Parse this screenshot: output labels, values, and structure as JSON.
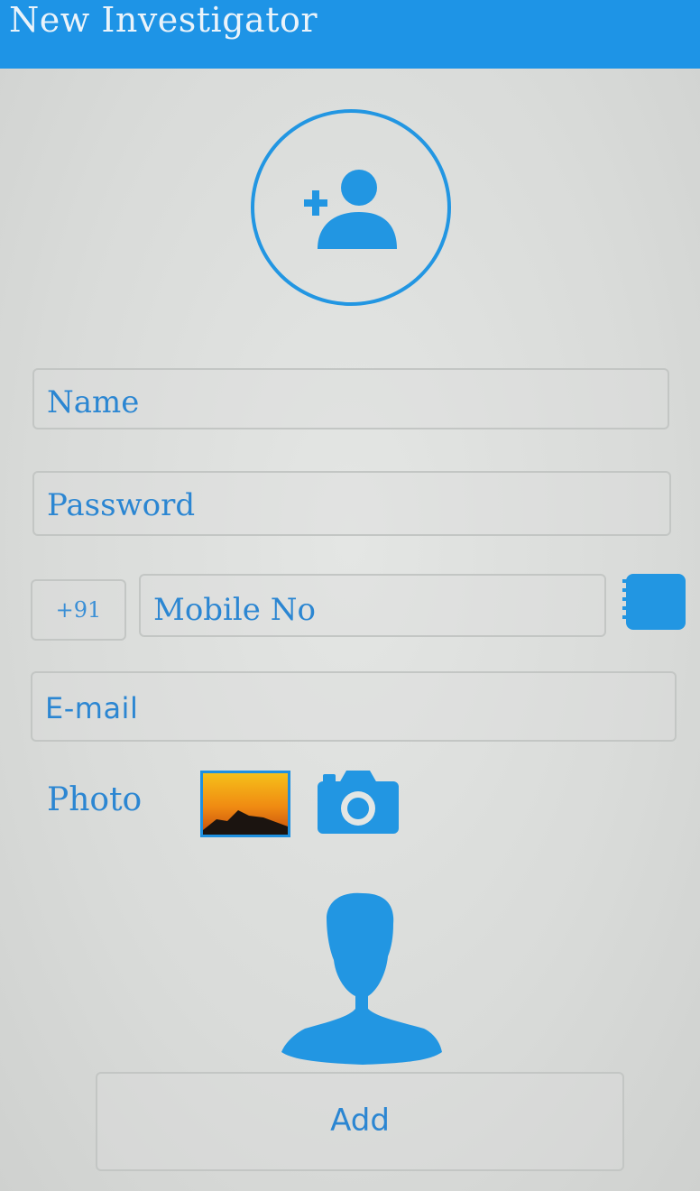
{
  "appbar": {
    "title": "New Investigator",
    "color": "#1e94e6"
  },
  "header_icon": "add-person-icon",
  "form": {
    "name_placeholder": "Name",
    "password_placeholder": "Password",
    "country_code": "+91",
    "mobile_placeholder": "Mobile No",
    "contacts_icon": "contacts-book-icon",
    "email_placeholder": "E-mail",
    "photo_label": "Photo",
    "gallery_icon": "gallery-image-icon",
    "camera_icon": "camera-icon",
    "preview_icon": "person-silhouette-icon"
  },
  "actions": {
    "add_label": "Add"
  },
  "colors": {
    "accent": "#1e94e6",
    "text": "#2b86d2",
    "background": "#d9dbd9"
  }
}
